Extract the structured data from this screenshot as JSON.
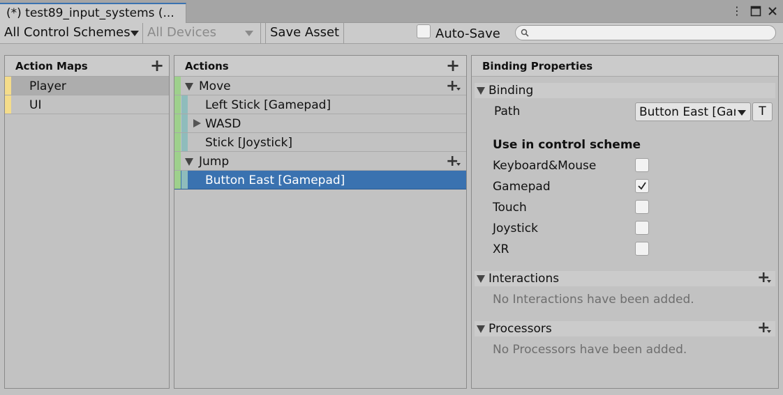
{
  "window": {
    "tab_title": "(*) test89_input_systems (...",
    "icons": [
      "more-vert-icon",
      "maximize-icon",
      "close-icon"
    ]
  },
  "toolbar": {
    "control_scheme": "All Control Schemes",
    "devices": "All Devices",
    "save_asset": "Save Asset",
    "auto_save_label": "Auto-Save",
    "auto_save_checked": false,
    "search_placeholder": ""
  },
  "action_maps": {
    "header": "Action Maps",
    "items": [
      {
        "label": "Player",
        "selected": true
      },
      {
        "label": "UI",
        "selected": false
      }
    ]
  },
  "actions": {
    "header": "Actions",
    "items": [
      {
        "label": "Move",
        "type": "action"
      },
      {
        "label": "Left Stick [Gamepad]",
        "type": "binding"
      },
      {
        "label": "WASD",
        "type": "composite"
      },
      {
        "label": "Stick [Joystick]",
        "type": "binding"
      },
      {
        "label": "Jump",
        "type": "action"
      },
      {
        "label": "Button East [Gamepad]",
        "type": "binding",
        "selected": true
      }
    ]
  },
  "binding_properties": {
    "header": "Binding Properties",
    "binding_section": "Binding",
    "path_label": "Path",
    "path_value": "Button East [Gamepad]",
    "t_button": "T",
    "scheme_heading": "Use in control scheme",
    "schemes": [
      {
        "label": "Keyboard&Mouse",
        "checked": false
      },
      {
        "label": "Gamepad",
        "checked": true
      },
      {
        "label": "Touch",
        "checked": false
      },
      {
        "label": "Joystick",
        "checked": false
      },
      {
        "label": "XR",
        "checked": false
      }
    ],
    "interactions_section": "Interactions",
    "interactions_empty": "No Interactions have been added.",
    "processors_section": "Processors",
    "processors_empty": "No Processors have been added."
  },
  "colors": {
    "selection": "#3a72b0",
    "action_map_strip": "#f4dc8a",
    "action_strip": "#9ed08c",
    "binding_strip": "#8fbcbc"
  }
}
